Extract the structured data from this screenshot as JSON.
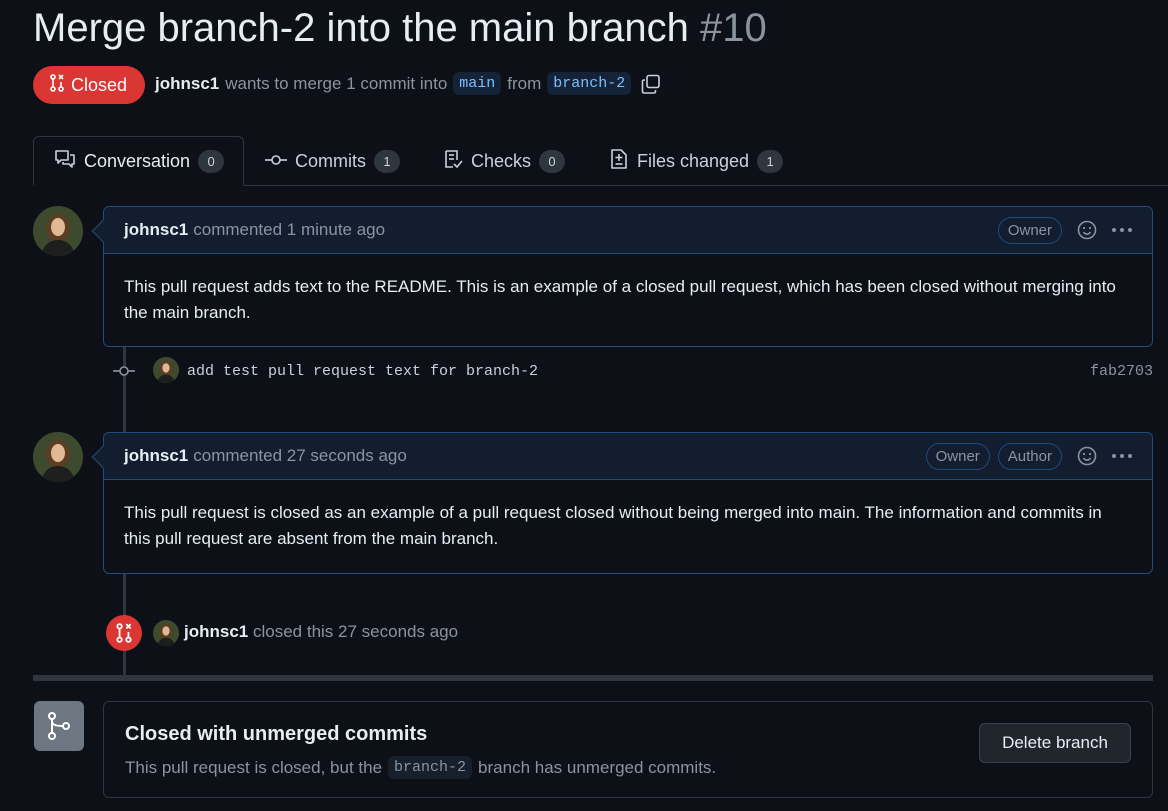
{
  "pr": {
    "title": "Merge branch-2 into the main branch",
    "number": "#10",
    "state": "Closed",
    "author": "johnsc1",
    "summary_text": "wants to merge 1 commit into",
    "base_branch": "main",
    "from_text": "from",
    "head_branch": "branch-2"
  },
  "tabs": [
    {
      "label": "Conversation",
      "count": "0"
    },
    {
      "label": "Commits",
      "count": "1"
    },
    {
      "label": "Checks",
      "count": "0"
    },
    {
      "label": "Files changed",
      "count": "1"
    }
  ],
  "comments": [
    {
      "author": "johnsc1",
      "meta": "commented 1 minute ago",
      "badges": [
        "Owner"
      ],
      "body": "This pull request adds text to the README. This is an example of a closed pull request, which has been closed without merging into the main branch."
    },
    {
      "author": "johnsc1",
      "meta": "commented 27 seconds ago",
      "badges": [
        "Owner",
        "Author"
      ],
      "body": "This pull request is closed as an example of a pull request closed without being merged into main. The information and commits in this pull request are absent from the main branch."
    }
  ],
  "commit": {
    "message": "add test pull request text for branch-2",
    "sha": "fab2703"
  },
  "close_event": {
    "actor": "johnsc1",
    "text": "closed this 27 seconds ago"
  },
  "merge_box": {
    "heading": "Closed with unmerged commits",
    "text_before": "This pull request is closed, but the",
    "branch": "branch-2",
    "text_after": "branch has unmerged commits.",
    "delete_button": "Delete branch"
  },
  "colors": {
    "background": "#0d1117",
    "closed_red": "#da3633",
    "branch_blue": "#79c0ff",
    "comment_border": "#1f4b7d"
  },
  "icons": {
    "state": "git-pull-request-closed-icon",
    "copy": "copy-icon",
    "conversation": "comment-discussion-icon",
    "commits": "git-commit-icon",
    "checks": "checklist-icon",
    "files": "file-diff-icon",
    "emoji": "smiley-icon",
    "more": "kebab-horizontal-icon",
    "merge": "git-branch-icon"
  }
}
